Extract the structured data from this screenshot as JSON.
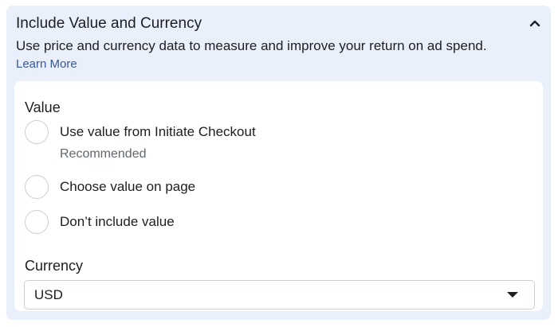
{
  "section": {
    "title": "Include Value and Currency",
    "collapse_icon": "chevron-up-icon",
    "description": "Use price and currency data to measure and improve your return on ad spend.",
    "learn_more": "Learn More"
  },
  "value": {
    "label": "Value",
    "options": [
      {
        "label": "Use value from Initiate Checkout",
        "sublabel": "Recommended",
        "selected": false
      },
      {
        "label": "Choose value on page",
        "selected": false
      },
      {
        "label": "Don’t include value",
        "selected": false
      }
    ]
  },
  "currency": {
    "label": "Currency",
    "selected": "USD",
    "dropdown_icon": "caret-down-icon"
  },
  "colors": {
    "panel_background": "#eaf0fb",
    "link": "#385898",
    "text": "#1c1e21",
    "secondary_text": "#606770",
    "border": "#ccd0d5"
  }
}
